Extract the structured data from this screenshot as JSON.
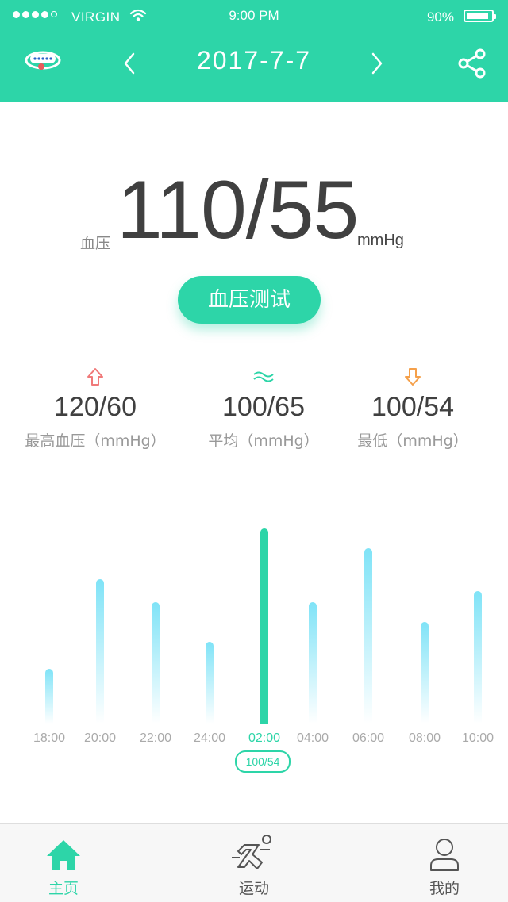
{
  "status_bar": {
    "carrier": "VIRGIN",
    "time": "9:00 PM",
    "battery_percent": "90%",
    "battery_level": 0.9,
    "signal_bars_filled": 4,
    "signal_bars_total": 5
  },
  "header": {
    "date": "2017-7-7",
    "device_icon": "wristband-icon",
    "prev_icon": "chevron-left-icon",
    "next_icon": "chevron-right-icon",
    "share_icon": "share-icon",
    "bg_color": "#2dd5a8"
  },
  "reading": {
    "label": "血压",
    "value": "110/55",
    "unit": "mmHg"
  },
  "test_button": {
    "label": "血压测试"
  },
  "stats": [
    {
      "icon": "arrow-up-icon",
      "color": "#f07a7a",
      "value": "120/60",
      "caption": "最高血压（mmHg）"
    },
    {
      "icon": "wave-icon",
      "color": "#2dd5a8",
      "value": "100/65",
      "caption": "平均（mmHg）"
    },
    {
      "icon": "arrow-down-icon",
      "color": "#f5a04a",
      "value": "100/54",
      "caption": "最低（mmHg）"
    }
  ],
  "chart_data": {
    "type": "bar",
    "categories": [
      "18:00",
      "20:00",
      "22:00",
      "24:00",
      "02:00",
      "04:00",
      "06:00",
      "08:00",
      "10:00"
    ],
    "values": [
      28,
      74,
      62,
      42,
      100,
      62,
      90,
      52,
      68
    ],
    "selected_index": 4,
    "selected_label": "100/54",
    "active_color": "#2dd5a8",
    "bar_color": "#7fe3f7"
  },
  "tabbar": [
    {
      "icon": "home-icon",
      "label": "主页",
      "active": true
    },
    {
      "icon": "running-icon",
      "label": "运动",
      "active": false
    },
    {
      "icon": "user-icon",
      "label": "我的",
      "active": false
    }
  ]
}
